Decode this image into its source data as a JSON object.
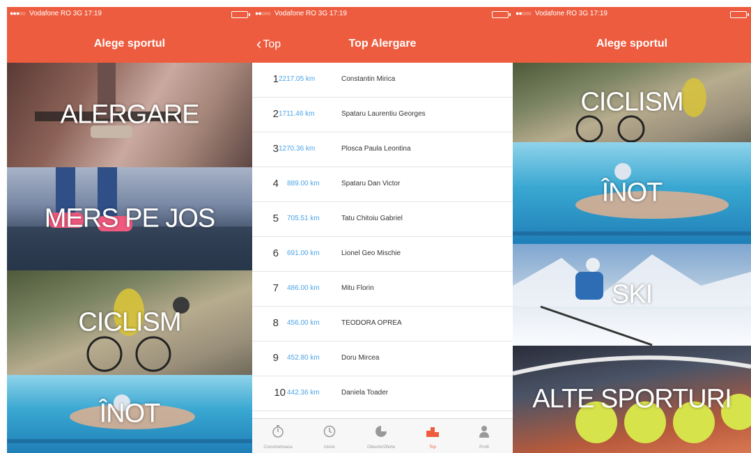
{
  "status": {
    "carrier": "Vodafone RO",
    "network": "3G",
    "time": "17:19"
  },
  "screen1": {
    "title": "Alege sportul",
    "sports": [
      "ALERGARE",
      "MERS PE JOS",
      "CICLISM",
      "ÎNOT"
    ]
  },
  "screen2": {
    "back_label": "Top",
    "title": "Top Alergare",
    "rows": [
      {
        "rank": "1",
        "km": "2217.05 km",
        "name": "Constantin Mirica"
      },
      {
        "rank": "2",
        "km": "1711.46 km",
        "name": "Spataru Laurentiu Georges"
      },
      {
        "rank": "3",
        "km": "1270.36 km",
        "name": "Ploscа Paula Leontina"
      },
      {
        "rank": "4",
        "km": "889.00 km",
        "name": "Spataru Dan Victor"
      },
      {
        "rank": "5",
        "km": "705.51 km",
        "name": "Tatu Chitoiu Gabriel"
      },
      {
        "rank": "6",
        "km": "691.00 km",
        "name": "Lionel Geo Mischie"
      },
      {
        "rank": "7",
        "km": "486.00 km",
        "name": "Mitu Florin"
      },
      {
        "rank": "8",
        "km": "456.00 km",
        "name": "TEODORA OPREA"
      },
      {
        "rank": "9",
        "km": "452.80 km",
        "name": "Doru Mircea"
      },
      {
        "rank": "10",
        "km": "442.36 km",
        "name": "Daniela Toader"
      }
    ],
    "tabs": [
      {
        "label": "Cronometreaza",
        "icon": "stopwatch-icon",
        "active": false
      },
      {
        "label": "Istoric",
        "icon": "history-icon",
        "active": false
      },
      {
        "label": "Obiectiv/Ofertе",
        "icon": "pie-chart-icon",
        "active": false
      },
      {
        "label": "Top",
        "icon": "podium-icon",
        "active": true
      },
      {
        "label": "Profil",
        "icon": "profile-icon",
        "active": false
      }
    ]
  },
  "screen3": {
    "title": "Alege sportul",
    "sports": [
      "CICLISM",
      "ÎNOT",
      "SKI",
      "ALTE SPORTURI"
    ]
  },
  "colors": {
    "accent": "#ee5c3f",
    "link": "#4aa3e8",
    "tab_inactive": "#999999"
  }
}
